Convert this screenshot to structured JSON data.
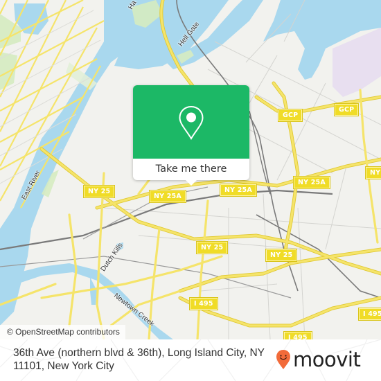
{
  "map": {
    "colors": {
      "land": "#f2f2ee",
      "water": "#a9d8ee",
      "park": "#d6ecc1",
      "major_road": "#f5e46a",
      "major_road_casing": "#e0c933",
      "minor_road": "#d4d4d0",
      "rail": "#7a7a7a",
      "airport": "#e8dff0"
    },
    "shields": [
      {
        "id": "gcp-1",
        "label": "GCP"
      },
      {
        "id": "gcp-2",
        "label": "GCP"
      },
      {
        "id": "ny25a-1",
        "label": "NY 25A"
      },
      {
        "id": "ny25a-2",
        "label": "NY 25A"
      },
      {
        "id": "ny25a-3",
        "label": "NY 25A"
      },
      {
        "id": "ny25a-4",
        "label": "NY"
      },
      {
        "id": "ny25-1",
        "label": "NY 25"
      },
      {
        "id": "ny25-2",
        "label": "NY 25"
      },
      {
        "id": "ny25-3",
        "label": "NY 25"
      },
      {
        "id": "i495-1",
        "label": "I 495"
      },
      {
        "id": "i495-2",
        "label": "I 495"
      },
      {
        "id": "i495-3",
        "label": "I 495"
      }
    ],
    "labels": {
      "east_river": "East River",
      "hell_gate": "Hell Gate",
      "newtown_creek": "Newtown Creek",
      "dutch_kills": "Dutch Kills",
      "harlem": "Ha"
    },
    "attribution": "© OpenStreetMap contributors"
  },
  "popup": {
    "icon": "map-pin-icon",
    "cta_label": "Take me there",
    "accent_color": "#1cb866"
  },
  "footer": {
    "address": "36th Ave (northern blvd & 36th), Long Island City, NY 11101, New York City",
    "brand": {
      "name": "moovit",
      "icon": "moovit-smile-pin-icon",
      "icon_color": "#f26b3a"
    }
  }
}
